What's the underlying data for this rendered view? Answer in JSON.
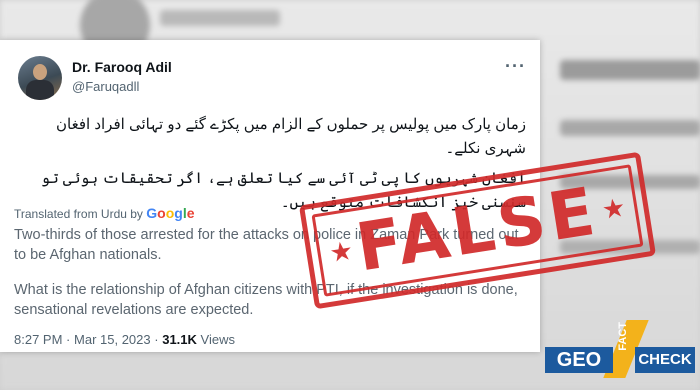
{
  "tweet": {
    "author_name": "Dr. Farooq Adil",
    "author_handle": "@Faruqadll",
    "urdu_text_1": "زمان پارک میں پولیس پر حملوں کے الزام میں پکڑے گئے دو تہائی افراد افغان شہری نکلے۔",
    "urdu_text_2": "افغان شہریوں کا پی ٹی آئی سے کیا تعلق ہے، اگر تحقیقات ہوئی تو سنسنی خیز انکشافات متوقع ہیں۔",
    "translated_label": "Translated from Urdu by",
    "google_letters": [
      "G",
      "o",
      "o",
      "g",
      "l",
      "e"
    ],
    "translation_1": "Two-thirds of those arrested for the attacks on police in Zaman Park turned out to be Afghan nationals.",
    "translation_2": "What is the relationship of Afghan citizens with PTI, if the investigation is done, sensational revelations are expected.",
    "time": "8:27 PM",
    "separator": "·",
    "date": "Mar 15, 2023",
    "views_count": "31.1K",
    "views_label": "Views",
    "more_icon": "more-icon"
  },
  "stamp": {
    "text": "FALSE",
    "color": "#d12a2a"
  },
  "logo": {
    "geo": "GEO",
    "fact": "FACT",
    "check": "CHECK",
    "brand_blue": "#1c5a9e",
    "brand_yellow": "#f3b21b"
  }
}
